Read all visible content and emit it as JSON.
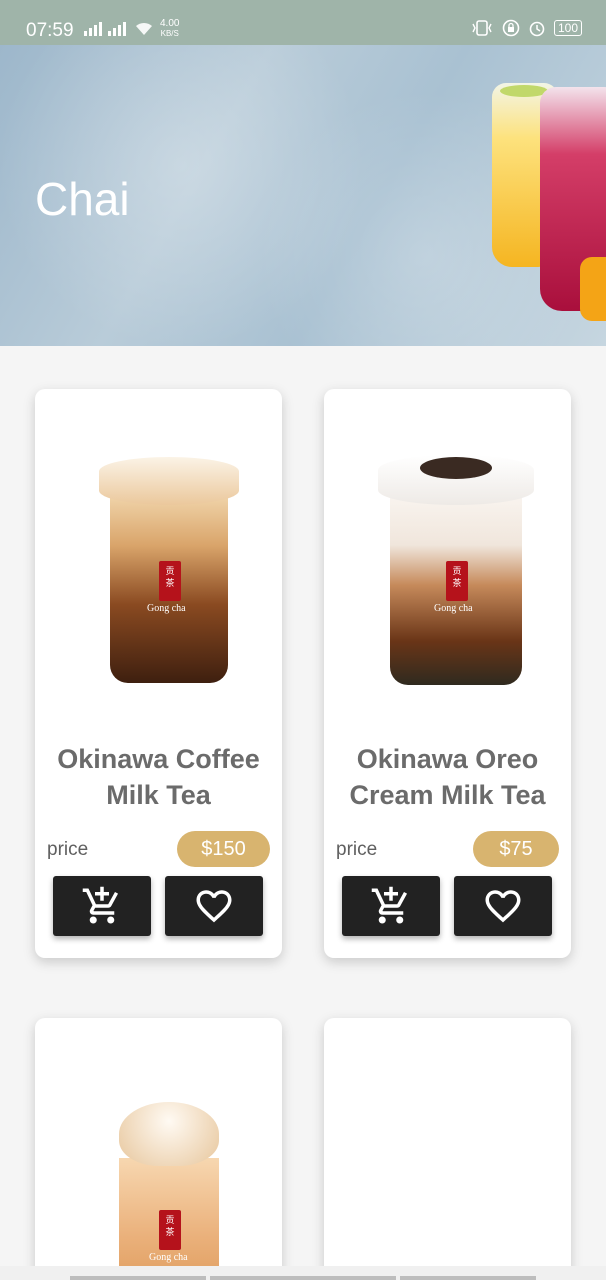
{
  "status_bar": {
    "time": "07:59",
    "net_speed_value": "4.00",
    "net_speed_unit": "KB/S",
    "battery": "100"
  },
  "header": {
    "title": "Chai"
  },
  "products": [
    {
      "name_line1": "Okinawa Coffee",
      "name_line2": "Milk Tea",
      "price_label": "price",
      "price": "$150",
      "add_icon": "add-to-cart-icon",
      "fav_icon": "heart-icon"
    },
    {
      "name_line1": "Okinawa Oreo",
      "name_line2": "Cream Milk Tea",
      "price_label": "price",
      "price": "$75",
      "add_icon": "add-to-cart-icon",
      "fav_icon": "heart-icon"
    },
    {
      "name_line1": "",
      "name_line2": "",
      "price_label": "",
      "price": ""
    },
    {
      "name_line1": "",
      "name_line2": "",
      "price_label": "",
      "price": ""
    }
  ],
  "drink_brand": "Gong cha",
  "colors": {
    "status_bar": "#9fb4a9",
    "price_pill": "#d8b46f",
    "button": "#222222",
    "title_text": "#6b6b6b"
  }
}
